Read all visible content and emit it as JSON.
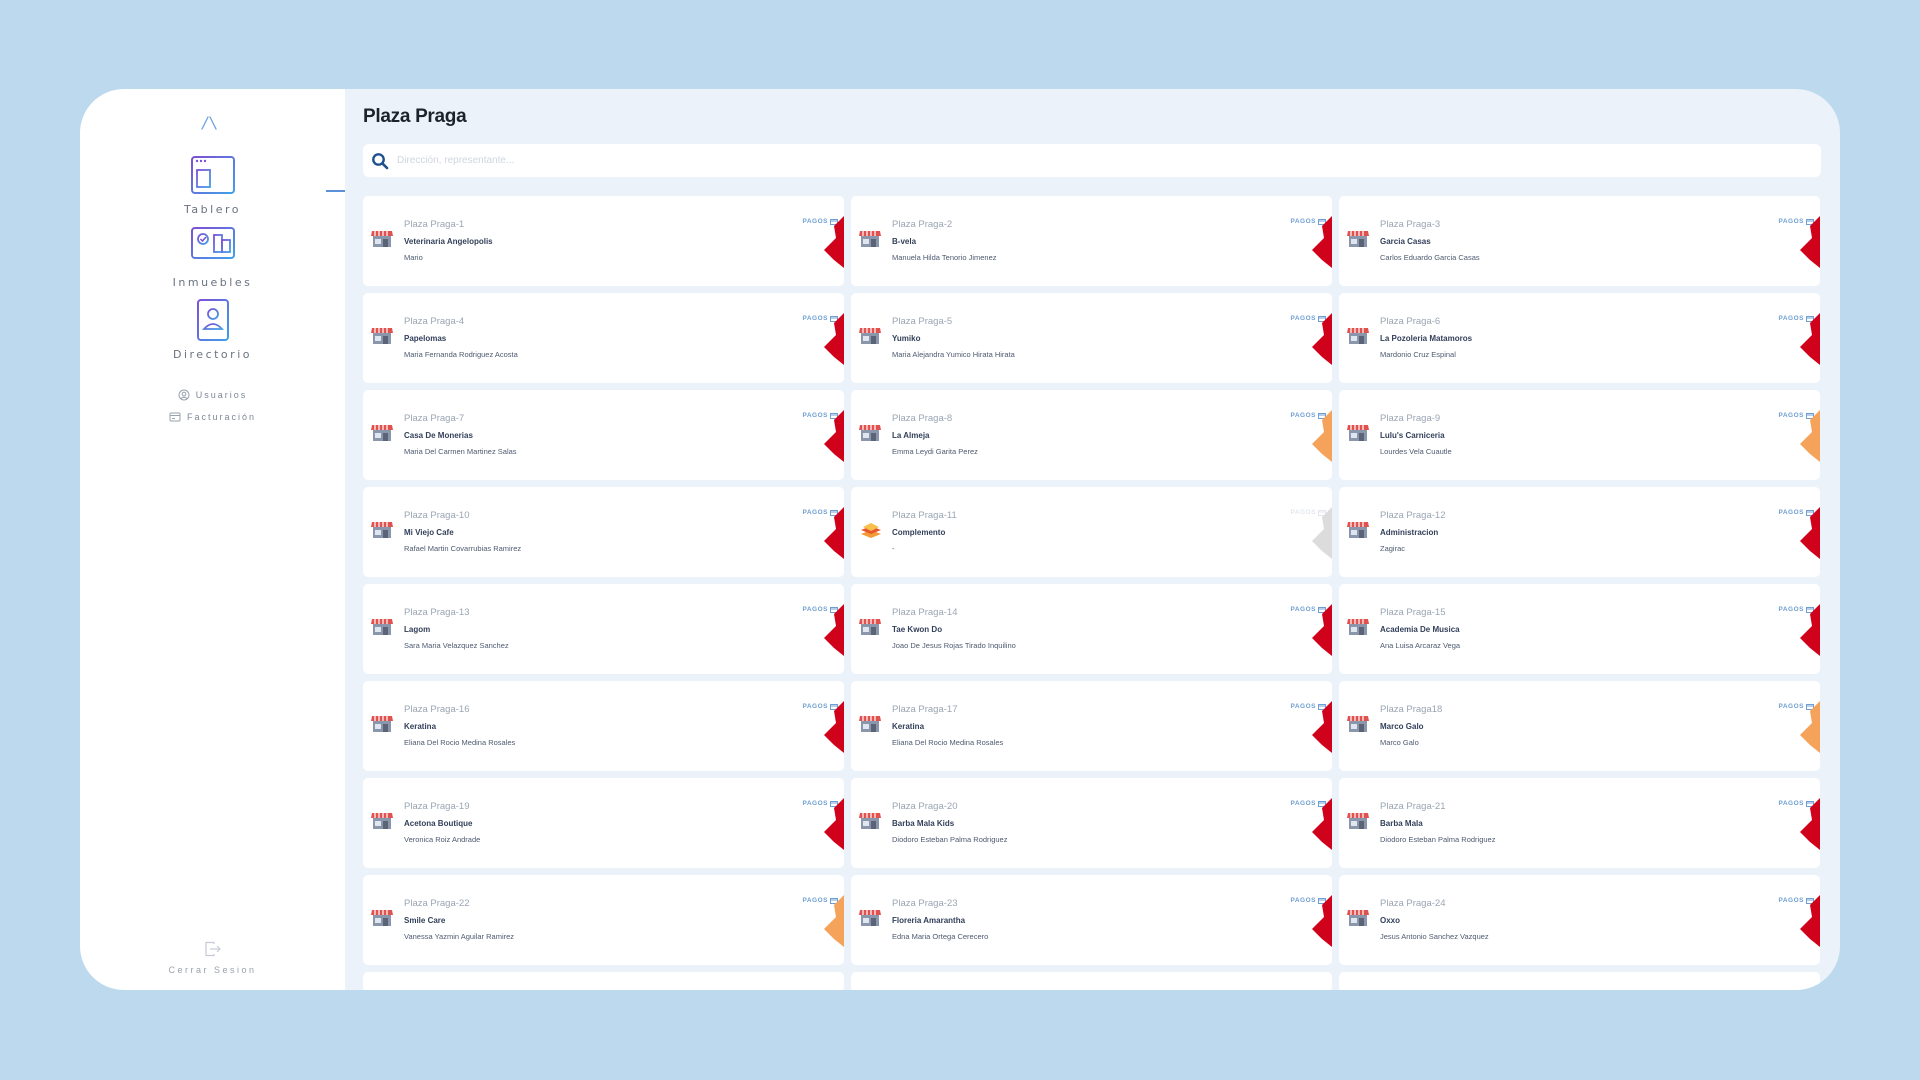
{
  "app": {
    "page_title": "Plaza Praga"
  },
  "sidebar": {
    "items": [
      {
        "label": "Tablero",
        "icon": "dashboard-icon"
      },
      {
        "label": "Inmuebles",
        "icon": "properties-icon"
      },
      {
        "label": "Directorio",
        "icon": "directory-icon"
      }
    ],
    "small_items": [
      {
        "label": "Usuarios",
        "icon": "user-icon"
      },
      {
        "label": "Facturación",
        "icon": "billing-icon"
      }
    ],
    "logout_label": "Cerrar Sesion"
  },
  "search": {
    "placeholder": "Dirección, representante..."
  },
  "colors": {
    "status_red": "#d0021b",
    "status_orange": "#f5a35b",
    "status_gray": "#dcdcdc",
    "accent": "#5b8fd6"
  },
  "cards": [
    {
      "code": "Plaza Praga-1",
      "name": "Veterinaria Angelopolis",
      "owner": "Mario",
      "pagos_label": "PAGOS",
      "status": "red",
      "icon": "storefront-icon"
    },
    {
      "code": "Plaza Praga-2",
      "name": "B-vela",
      "owner": "Manuela Hilda Tenorio Jimenez",
      "pagos_label": "PAGOS",
      "status": "red",
      "icon": "storefront-icon"
    },
    {
      "code": "Plaza Praga-3",
      "name": "Garcia Casas",
      "owner": "Carlos Eduardo Garcia Casas",
      "pagos_label": "PAGOS",
      "status": "red",
      "icon": "storefront-icon"
    },
    {
      "code": "Plaza Praga-4",
      "name": "Papelomas",
      "owner": "Maria Fernanda Rodriguez Acosta",
      "pagos_label": "PAGOS",
      "status": "red",
      "icon": "storefront-icon"
    },
    {
      "code": "Plaza Praga-5",
      "name": "Yumiko",
      "owner": "Maria Alejandra Yumico Hirata Hirata",
      "pagos_label": "PAGOS",
      "status": "red",
      "icon": "storefront-icon"
    },
    {
      "code": "Plaza Praga-6",
      "name": "La Pozoleria Matamoros",
      "owner": "Mardonio Cruz Espinal",
      "pagos_label": "PAGOS",
      "status": "red",
      "icon": "storefront-icon"
    },
    {
      "code": "Plaza Praga-7",
      "name": "Casa De Monerias",
      "owner": "Maria Del Carmen Martinez Salas",
      "pagos_label": "PAGOS",
      "status": "red",
      "icon": "storefront-icon"
    },
    {
      "code": "Plaza Praga-8",
      "name": "La Almeja",
      "owner": "Emma Leydi Garita Perez",
      "pagos_label": "PAGOS",
      "status": "orange",
      "icon": "storefront-icon"
    },
    {
      "code": "Plaza Praga-9",
      "name": "Lulu's Carniceria",
      "owner": "Lourdes Vela Cuautle",
      "pagos_label": "PAGOS",
      "status": "orange",
      "icon": "storefront-icon"
    },
    {
      "code": "Plaza Praga-10",
      "name": "Mi Viejo Cafe",
      "owner": "Rafael Martin Covarrubias Ramirez",
      "pagos_label": "PAGOS",
      "status": "red",
      "icon": "storefront-icon"
    },
    {
      "code": "Plaza Praga-11",
      "name": "Complemento",
      "owner": "-",
      "pagos_label": "PAGOS",
      "status": "gray",
      "icon": "stack-icon"
    },
    {
      "code": "Plaza Praga-12",
      "name": "Administracion",
      "owner": "Zagirac",
      "pagos_label": "PAGOS",
      "status": "red",
      "icon": "storefront-icon"
    },
    {
      "code": "Plaza Praga-13",
      "name": "Lagom",
      "owner": "Sara Maria Velazquez Sanchez",
      "pagos_label": "PAGOS",
      "status": "red",
      "icon": "storefront-icon"
    },
    {
      "code": "Plaza Praga-14",
      "name": "Tae Kwon Do",
      "owner": "Joao De Jesus Rojas Tirado Inquilino",
      "pagos_label": "PAGOS",
      "status": "red",
      "icon": "storefront-icon"
    },
    {
      "code": "Plaza Praga-15",
      "name": "Academia De Musica",
      "owner": "Ana Luisa Arcaraz Vega",
      "pagos_label": "PAGOS",
      "status": "red",
      "icon": "storefront-icon"
    },
    {
      "code": "Plaza Praga-16",
      "name": "Keratina",
      "owner": "Eliana Del Rocio Medina Rosales",
      "pagos_label": "PAGOS",
      "status": "red",
      "icon": "storefront-icon"
    },
    {
      "code": "Plaza Praga-17",
      "name": "Keratina",
      "owner": "Eliana Del Rocio Medina Rosales",
      "pagos_label": "PAGOS",
      "status": "red",
      "icon": "storefront-icon"
    },
    {
      "code": "Plaza Praga18",
      "name": "Marco Galo",
      "owner": "Marco Galo",
      "pagos_label": "PAGOS",
      "status": "orange",
      "icon": "storefront-icon"
    },
    {
      "code": "Plaza Praga-19",
      "name": "Acetona Boutique",
      "owner": "Veronica Roiz Andrade",
      "pagos_label": "PAGOS",
      "status": "red",
      "icon": "storefront-icon"
    },
    {
      "code": "Plaza Praga-20",
      "name": "Barba Mala Kids",
      "owner": "Diodoro Esteban Palma Rodriguez",
      "pagos_label": "PAGOS",
      "status": "red",
      "icon": "storefront-icon"
    },
    {
      "code": "Plaza Praga-21",
      "name": "Barba Mala",
      "owner": "Diodoro Esteban Palma Rodriguez",
      "pagos_label": "PAGOS",
      "status": "red",
      "icon": "storefront-icon"
    },
    {
      "code": "Plaza Praga-22",
      "name": "Smile Care",
      "owner": "Vanessa Yazmin Aguilar Ramirez",
      "pagos_label": "PAGOS",
      "status": "orange",
      "icon": "storefront-icon"
    },
    {
      "code": "Plaza Praga-23",
      "name": "Floreria Amarantha",
      "owner": "Edna Maria Ortega Cerecero",
      "pagos_label": "PAGOS",
      "status": "red",
      "icon": "storefront-icon"
    },
    {
      "code": "Plaza Praga-24",
      "name": "Oxxo",
      "owner": "Jesus Antonio Sanchez Vazquez",
      "pagos_label": "PAGOS",
      "status": "red",
      "icon": "storefront-icon"
    }
  ]
}
